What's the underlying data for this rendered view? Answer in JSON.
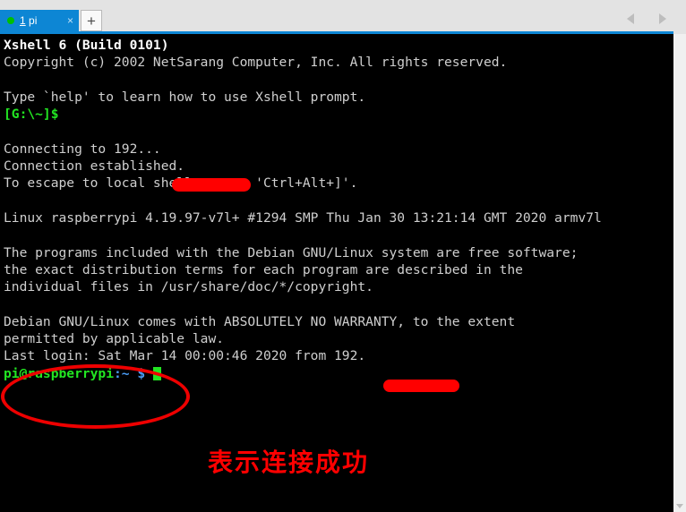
{
  "window": {
    "accent_color": "#0d86d4",
    "chrome_background": "#e3e3e3"
  },
  "tabbar": {
    "tab": {
      "status_dot_color": "#00c000",
      "number": "1",
      "name": " pi",
      "close_label": "×"
    },
    "new_tab_label": "+",
    "nav_prev_label": "",
    "nav_next_label": ""
  },
  "terminal": {
    "background_color": "#000000",
    "default_text_color": "#cdcdcd",
    "lines": [
      {
        "text": "Xshell 6 (Build 0101)",
        "style": "w-bold"
      },
      {
        "text": "Copyright (c) 2002 NetSarang Computer, Inc. All rights reserved.",
        "style": "w-norm"
      },
      {
        "text": "",
        "style": "w-norm"
      },
      {
        "text": "Type `help' to learn how to use Xshell prompt.",
        "style": "w-norm"
      },
      {
        "text": "[G:\\~]$",
        "style": "g-bold"
      },
      {
        "text": "",
        "style": "w-norm"
      },
      {
        "text": "Connecting to 192...",
        "style": "w-norm"
      },
      {
        "text": "Connection established.",
        "style": "w-norm"
      },
      {
        "text": "To escape to local shell, press 'Ctrl+Alt+]'.",
        "style": "w-norm"
      },
      {
        "text": "",
        "style": "w-norm"
      },
      {
        "text": "Linux raspberrypi 4.19.97-v7l+ #1294 SMP Thu Jan 30 13:21:14 GMT 2020 armv7l",
        "style": "w-norm"
      },
      {
        "text": "",
        "style": "w-norm"
      },
      {
        "text": "The programs included with the Debian GNU/Linux system are free software;",
        "style": "w-norm"
      },
      {
        "text": "the exact distribution terms for each program are described in the",
        "style": "w-norm"
      },
      {
        "text": "individual files in /usr/share/doc/*/copyright.",
        "style": "w-norm"
      },
      {
        "text": "",
        "style": "w-norm"
      },
      {
        "text": "Debian GNU/Linux comes with ABSOLUTELY NO WARRANTY, to the extent",
        "style": "w-norm"
      },
      {
        "text": "permitted by applicable law.",
        "style": "w-norm"
      },
      {
        "text": "Last login: Sat Mar 14 00:00:46 2020 from 192.",
        "style": "w-norm"
      }
    ],
    "prompt": {
      "user_host": "pi@raspberrypi",
      "path": ":~",
      "symbol": "$",
      "user_host_color": "#22e522",
      "path_color": "#4a9cf5",
      "symbol_color": "#4a9cf5",
      "cursor_color": "#22e522"
    }
  },
  "annotations": {
    "highlight_color": "#ee0000",
    "redaction_color": "#ff0000",
    "note_text": "表示连接成功",
    "redaction_1_label": "redacted-ip-connecting",
    "redaction_2_label": "redacted-ip-last-login"
  }
}
